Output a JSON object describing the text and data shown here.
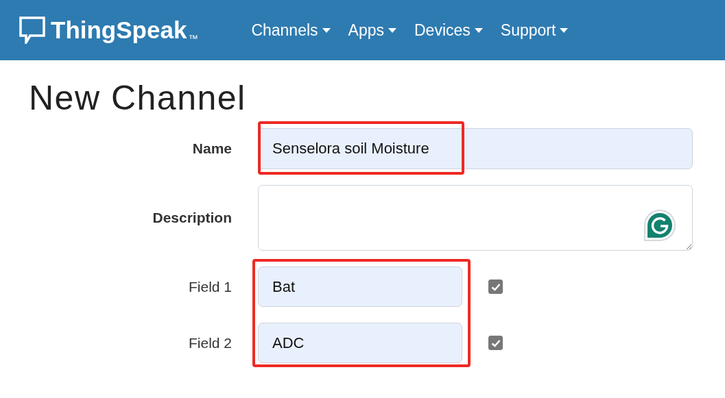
{
  "navbar": {
    "brand": "ThingSpeak",
    "trademark": "™",
    "menu": [
      {
        "label": "Channels",
        "dropdown": true
      },
      {
        "label": "Apps",
        "dropdown": true
      },
      {
        "label": "Devices",
        "dropdown": true
      },
      {
        "label": "Support",
        "dropdown": true
      }
    ]
  },
  "title": "New Channel",
  "form": {
    "name": {
      "label": "Name",
      "value": "Senselora soil Moisture",
      "highlighted": true
    },
    "description": {
      "label": "Description"
    },
    "fields_highlighted": true,
    "fields": [
      {
        "label": "Field 1",
        "value": "Bat",
        "checked": true
      },
      {
        "label": "Field 2",
        "value": "ADC",
        "checked": true
      }
    ]
  }
}
